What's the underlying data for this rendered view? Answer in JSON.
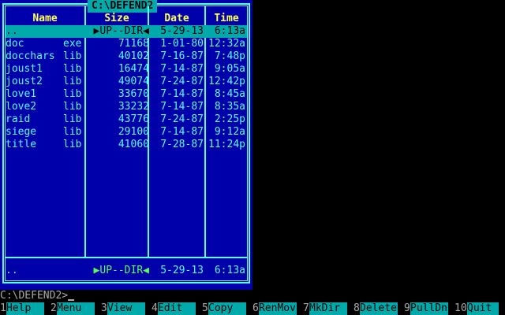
{
  "panel": {
    "path": "C:\\DEFEND2",
    "headers": {
      "name": "Name",
      "size": "Size",
      "date": "Date",
      "time": "Time"
    },
    "files": [
      {
        "name": "..",
        "ext": "",
        "size": "▶UP--DIR◀",
        "date": "5-29-13",
        "time": "6:13a",
        "selected": true
      },
      {
        "name": "doc",
        "ext": "exe",
        "size": "71168",
        "date": "1-01-80",
        "time": "12:32a"
      },
      {
        "name": "docchars",
        "ext": "lib",
        "size": "40102",
        "date": "7-16-87",
        "time": "7:48p"
      },
      {
        "name": "joust1",
        "ext": "lib",
        "size": "16474",
        "date": "7-14-87",
        "time": "9:05a"
      },
      {
        "name": "joust2",
        "ext": "lib",
        "size": "49074",
        "date": "7-24-87",
        "time": "12:42p"
      },
      {
        "name": "love1",
        "ext": "lib",
        "size": "33670",
        "date": "7-14-87",
        "time": "8:45a"
      },
      {
        "name": "love2",
        "ext": "lib",
        "size": "33232",
        "date": "7-14-87",
        "time": "8:35a"
      },
      {
        "name": "raid",
        "ext": "lib",
        "size": "43776",
        "date": "7-24-87",
        "time": "2:25p"
      },
      {
        "name": "siege",
        "ext": "lib",
        "size": "29100",
        "date": "7-14-87",
        "time": "9:12a"
      },
      {
        "name": "title",
        "ext": "lib",
        "size": "41060",
        "date": "7-28-87",
        "time": "11:24p"
      }
    ],
    "footer": {
      "name": "..",
      "size": "▶UP--DIR◀",
      "date": "5-29-13",
      "time": "6:13a"
    }
  },
  "cmdline": {
    "prompt": "C:\\DEFEND2>"
  },
  "fkeys": [
    {
      "num": "1",
      "label": "Help"
    },
    {
      "num": "2",
      "label": "Menu"
    },
    {
      "num": "3",
      "label": "View"
    },
    {
      "num": "4",
      "label": "Edit"
    },
    {
      "num": "5",
      "label": "Copy"
    },
    {
      "num": "6",
      "label": "RenMov"
    },
    {
      "num": "7",
      "label": "MkDir"
    },
    {
      "num": "8",
      "label": "Delete"
    },
    {
      "num": "9",
      "label": "PullDn"
    },
    {
      "num": "10",
      "label": "Quit"
    }
  ],
  "colors": {
    "panel_bg": "#0000aa",
    "frame": "#55ffff",
    "header_text": "#ffff55",
    "selection_bg": "#00aaaa",
    "updir_green": "#55ff55"
  }
}
